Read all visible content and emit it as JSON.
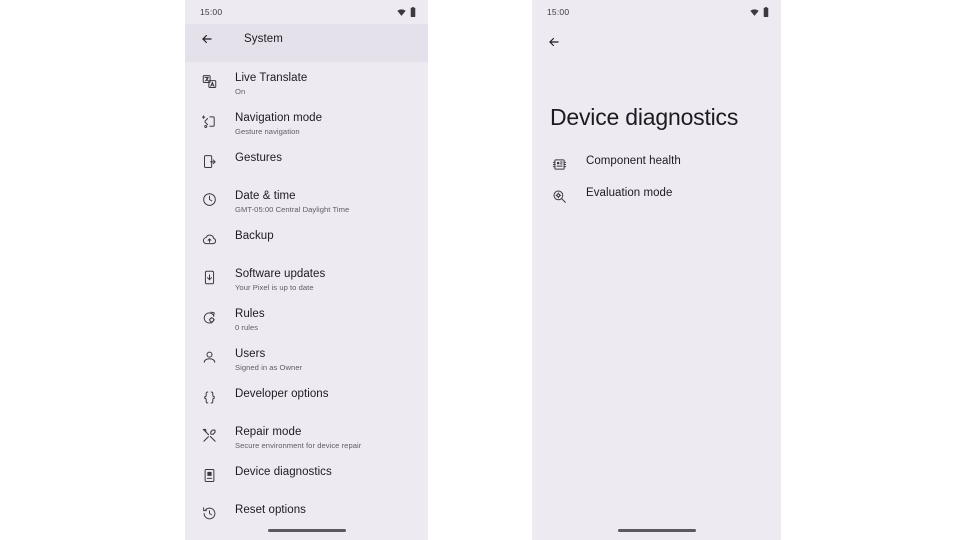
{
  "left_phone": {
    "status_bar": {
      "clock": "15:00",
      "icons": [
        "wifi-icon",
        "battery-icon"
      ]
    },
    "app_bar": {
      "back_label": "Back",
      "title": "System"
    },
    "items": [
      {
        "icon": "live-translate-icon",
        "title": "Live Translate",
        "subtitle": "On"
      },
      {
        "icon": "navigation-mode-icon",
        "title": "Navigation mode",
        "subtitle": "Gesture navigation"
      },
      {
        "icon": "gestures-icon",
        "title": "Gestures",
        "subtitle": ""
      },
      {
        "icon": "clock-icon",
        "title": "Date & time",
        "subtitle": "GMT-05:00 Central Daylight Time"
      },
      {
        "icon": "cloud-upload-icon",
        "title": "Backup",
        "subtitle": ""
      },
      {
        "icon": "software-update-icon",
        "title": "Software updates",
        "subtitle": "Your Pixel is up to date"
      },
      {
        "icon": "rules-icon",
        "title": "Rules",
        "subtitle": "0 rules"
      },
      {
        "icon": "person-icon",
        "title": "Users",
        "subtitle": "Signed in as Owner"
      },
      {
        "icon": "braces-icon",
        "title": "Developer options",
        "subtitle": ""
      },
      {
        "icon": "repair-tools-icon",
        "title": "Repair mode",
        "subtitle": "Secure environment for device repair"
      },
      {
        "icon": "device-diagnostics-icon",
        "title": "Device diagnostics",
        "subtitle": ""
      },
      {
        "icon": "history-restore-icon",
        "title": "Reset options",
        "subtitle": ""
      }
    ],
    "gesture_bar": "home-gesture-pill"
  },
  "right_phone": {
    "status_bar": {
      "clock": "15:00",
      "icons": [
        "wifi-icon",
        "battery-icon"
      ]
    },
    "app_bar": {
      "back_label": "Back"
    },
    "page_title": "Device diagnostics",
    "items": [
      {
        "icon": "component-health-icon",
        "title": "Component health",
        "subtitle": ""
      },
      {
        "icon": "evaluation-mode-icon",
        "title": "Evaluation mode",
        "subtitle": ""
      }
    ],
    "gesture_bar": "home-gesture-pill"
  },
  "colors": {
    "page_background": "#ffffff",
    "phone_surface": "#edeaf1",
    "app_bar_tint": "#e4e1ea",
    "primary_text": "#1c1b20",
    "secondary_text": "#5f5d66",
    "gesture_pill": "#5a5860"
  }
}
